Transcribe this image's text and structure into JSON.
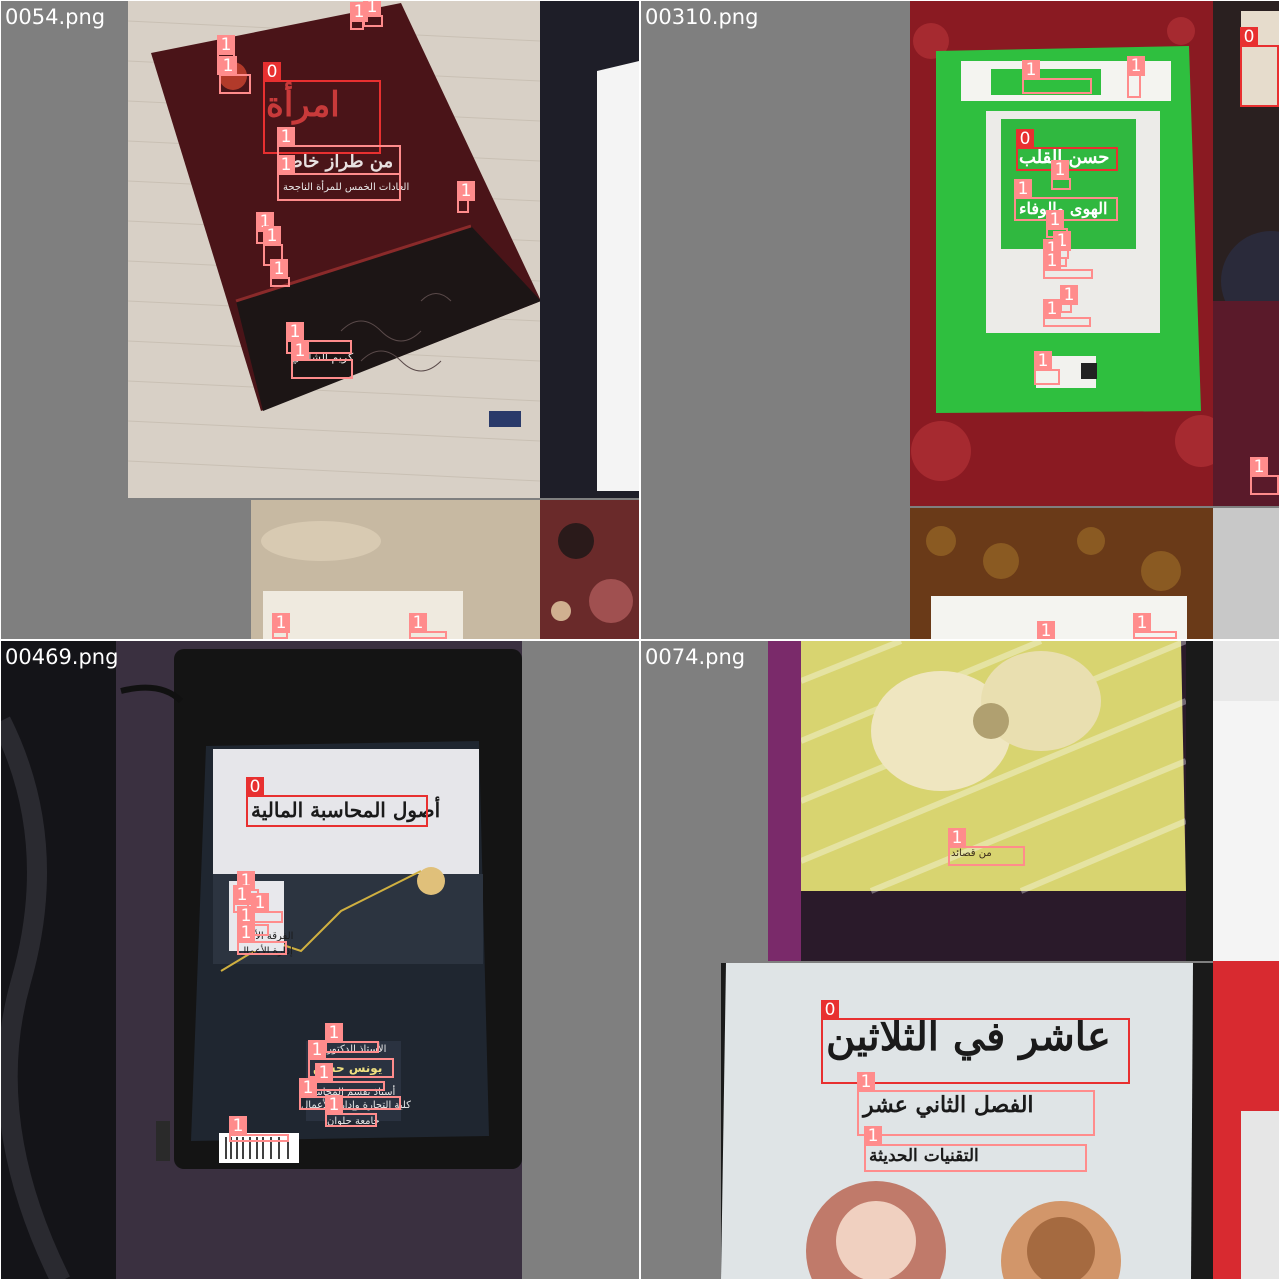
{
  "tiles": [
    {
      "filename": "0054.png",
      "class_labels": {
        "c0": "0",
        "c1": "1"
      },
      "cover_texts": {
        "title": "امرأة",
        "subtitle": "من طراز خاص",
        "tagline": "العادات الخمس للمرأة الناجحة",
        "author": "كريم الشاذلي"
      }
    },
    {
      "filename": "00310.png",
      "class_labels": {
        "c0": "0",
        "c1": "1"
      },
      "cover_texts": {
        "title": "حسن القلب",
        "subtitle": "الهوى والوفاء"
      }
    },
    {
      "filename": "00469.png",
      "class_labels": {
        "c0": "0",
        "c1": "1"
      },
      "cover_texts": {
        "title": "أصول المحاسبة المالية",
        "line1": "الفرقة الأولى",
        "line2": "إدارة الأعمال",
        "author": "يونس حسن",
        "l3": "الأستاذ الدكتور",
        "l4": "أستاذ بقسم المحاسبة",
        "l5": "كلية التجارة وإدارة الأعمال",
        "l6": "جامعة حلوان"
      }
    },
    {
      "filename": "0074.png",
      "class_labels": {
        "c0": "0",
        "c1": "1"
      },
      "cover_texts": {
        "title": "عاشر في الثلاثين",
        "line1": "الفصل الثاني عشر",
        "line2": "التقنيات الحديثة",
        "top_caption": "من قصائد"
      }
    }
  ]
}
